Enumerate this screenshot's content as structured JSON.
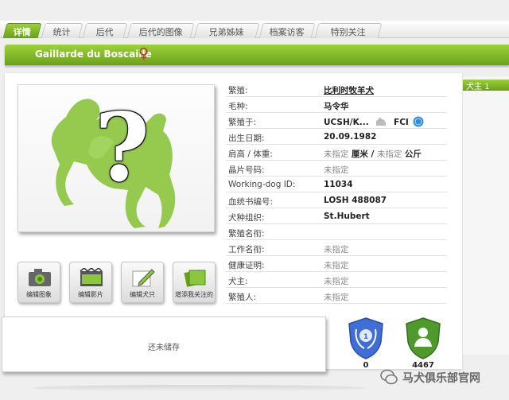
{
  "tabs": [
    {
      "label": "详情",
      "active": true
    },
    {
      "label": "统计",
      "active": false
    },
    {
      "label": "后代",
      "active": false
    },
    {
      "label": "后代的图像",
      "active": false
    },
    {
      "label": "兄弟姊妹",
      "active": false
    },
    {
      "label": "档案访客",
      "active": false
    },
    {
      "label": "特别关注",
      "active": false
    }
  ],
  "dog": {
    "name": "Gaillarde du Boscaille",
    "sex_symbol": "♀"
  },
  "photo": {
    "placeholder_symbol": "?"
  },
  "actions": [
    {
      "label": "编辑图象",
      "icon": "camera-icon"
    },
    {
      "label": "编辑影片",
      "icon": "film-icon"
    },
    {
      "label": "编辑犬只",
      "icon": "pencil-icon"
    },
    {
      "label": "增添我关注的",
      "icon": "bookmark-icon"
    }
  ],
  "storage_text": "还未储存",
  "info": {
    "breed_label": "繁殖:",
    "breed_value": "比利时牧羊犬",
    "coat_label": "毛种:",
    "coat_value": "马令华",
    "bred_in_label": "繁殖于:",
    "bred_in_value": "UCSH/K...",
    "bred_in_fci": "FCI",
    "dob_label": "出生日期:",
    "dob_value": "20.09.1982",
    "size_label": "肩高 / 体重:",
    "size_na1": "未指定",
    "size_u1": "厘米",
    "size_sep": " / ",
    "size_na2": "未指定",
    "size_u2": "公斤",
    "chip_label": "晶片号码:",
    "chip_value": "未指定",
    "wdid_label": "Working-dog ID:",
    "wdid_value": "11034",
    "reg_label": "血统书编号:",
    "reg_value": "LOSH 488087",
    "club_label": "犬种组织:",
    "club_value": "St.Hubert",
    "kennel_label": "繁殖名衔:",
    "kennel_value": "",
    "work_label": "工作名衔:",
    "work_value": "未指定",
    "health_label": "健康证明:",
    "health_value": "未指定",
    "owner_label": "犬主:",
    "owner_value": "未指定",
    "breeder_label": "繁殖人:",
    "breeder_value": "未指定"
  },
  "badges": [
    {
      "value": "0",
      "icon": "laurel-shield-icon",
      "color": "#3f6fd6"
    },
    {
      "value": "4467",
      "icon": "person-shield-icon",
      "color": "#4e9a2c"
    }
  ],
  "right_tab": {
    "label": "犬主",
    "count": "1"
  },
  "watermark": "马犬俱乐部官网",
  "colors": {
    "accent": "#7ab526",
    "female": "#b53a3a"
  }
}
